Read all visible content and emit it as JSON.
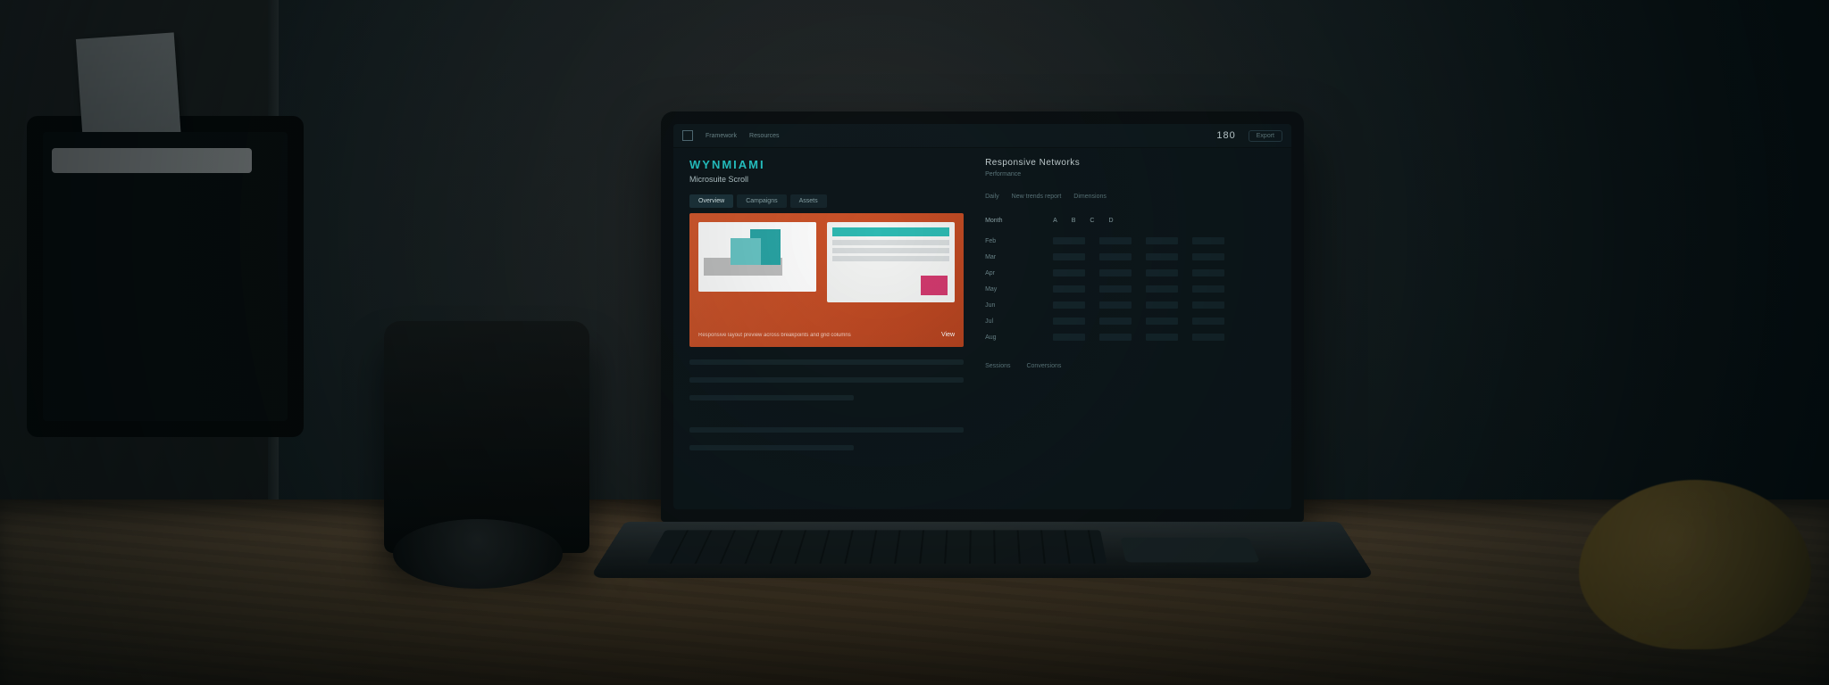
{
  "topbar": {
    "nav1": "Framework",
    "nav2": "Resources",
    "metric": "180",
    "pill": "Export"
  },
  "left": {
    "brand": "WYNMIAMI",
    "subtitle": "Microsuite Scroll",
    "tabs": [
      "Overview",
      "Campaigns",
      "Assets"
    ],
    "hero_caption": "Responsive layout preview across breakpoints and grid columns",
    "hero_btn": "View"
  },
  "right": {
    "title": "Responsive Networks",
    "subtitle": "Performance",
    "filters": [
      "Daily",
      "New trends report",
      "Dimensions"
    ],
    "columns": [
      "Month",
      "A",
      "B",
      "C",
      "D"
    ],
    "rows": [
      "Feb",
      "Mar",
      "Apr",
      "May",
      "Jun",
      "Jul",
      "Aug"
    ],
    "legend": [
      "Sessions",
      "Conversions"
    ]
  }
}
